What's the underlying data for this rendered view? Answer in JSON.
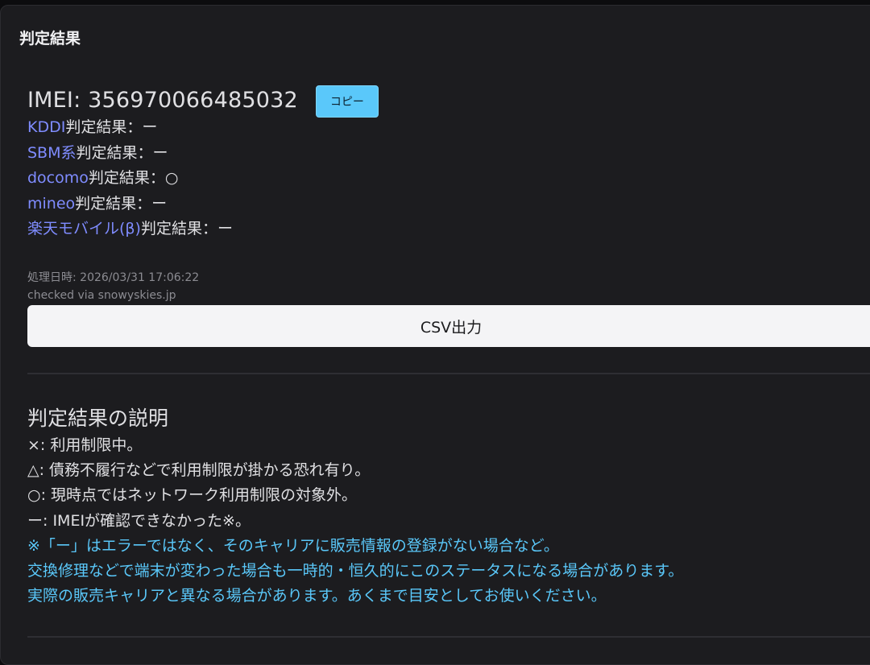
{
  "panel": {
    "title": "判定結果"
  },
  "imei": {
    "text": "IMEI: 356970066485032",
    "copy_label": "コピー"
  },
  "results": [
    {
      "carrier": "KDDI",
      "label": "判定結果：",
      "value": "ー"
    },
    {
      "carrier": "SBM系",
      "label": "判定結果：",
      "value": "ー"
    },
    {
      "carrier": "docomo",
      "label": "判定結果：",
      "value": "○"
    },
    {
      "carrier": "mineo",
      "label": "判定結果：",
      "value": "ー"
    },
    {
      "carrier": "楽天モバイル(β)",
      "label": "判定結果：",
      "value": "ー"
    }
  ],
  "meta": {
    "processed": "処理日時: 2026/03/31 17:06:22",
    "checked_via": "checked via snowyskies.jp"
  },
  "csv_button": "CSV出力",
  "explanation": {
    "title": "判定結果の説明",
    "lines": [
      "×: 利用制限中。",
      "△: 債務不履行などで利用制限が掛かる恐れ有り。",
      "○: 現時点ではネットワーク利用制限の対象外。",
      "ー: IMEIが確認できなかった※。"
    ],
    "notes": [
      "※「ー」はエラーではなく、そのキャリアに販売情報の登録がない場合など。",
      "交換修理などで端末が変わった場合も一時的・恒久的にこのステータスになる場合があります。",
      "実際の販売キャリアと異なる場合があります。あくまで目安としてお使いください。"
    ]
  },
  "colors": {
    "carrier_link": "#7f8cff",
    "note": "#5ac8fa",
    "copy_button": "#5ac8fa",
    "panel_bg": "#1c1c1f"
  }
}
